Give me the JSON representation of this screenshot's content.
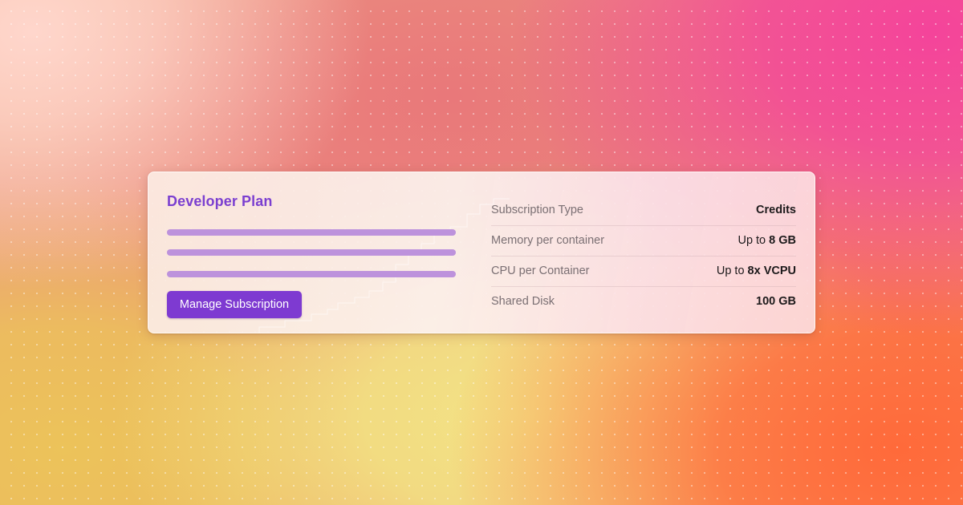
{
  "plan": {
    "title": "Developer Plan",
    "manage_button": "Manage Subscription"
  },
  "specs": [
    {
      "label": "Subscription Type",
      "value_prefix": "",
      "value": "Credits"
    },
    {
      "label": "Memory per container",
      "value_prefix": "Up to ",
      "value": "8 GB"
    },
    {
      "label": "CPU per Container",
      "value_prefix": "Up to ",
      "value": "8x VCPU"
    },
    {
      "label": "Shared Disk",
      "value_prefix": "",
      "value": "100 GB"
    }
  ],
  "colors": {
    "accent": "#7e3ad1",
    "title": "#7b3fd0",
    "bars": "#bd92dc"
  }
}
